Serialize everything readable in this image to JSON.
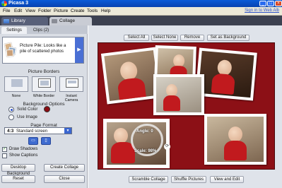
{
  "window": {
    "title": "Picasa 3"
  },
  "menubar": {
    "items": [
      "File",
      "Edit",
      "View",
      "Folder",
      "Picture",
      "Create",
      "Tools",
      "Help"
    ],
    "signin": "Sign in to Web Alb"
  },
  "tabs": {
    "library": "Library",
    "collage": "Collage"
  },
  "panel": {
    "subtabs": {
      "settings": "Settings",
      "clips": "Clips (2)"
    },
    "style": {
      "text": "Picture Pile: Looks like a pile of scattered photos"
    },
    "borders": {
      "title": "Picture Borders",
      "options": [
        {
          "label": "None"
        },
        {
          "label": "White Border"
        },
        {
          "label": "Instant Camera"
        }
      ]
    },
    "background": {
      "title": "Background Options",
      "solid": "Solid Color",
      "image": "Use Image",
      "color": "#8c1016"
    },
    "format": {
      "title": "Page Format",
      "ratio": "4:3",
      "name": "Standard screen"
    },
    "checks": {
      "shadows": "Draw Shadows",
      "captions": "Show Captions"
    },
    "buttons": {
      "desktop": "Desktop Background",
      "create": "Create Collage",
      "reset": "Reset",
      "close": "Close"
    }
  },
  "toolbar": {
    "select_all": "Select All",
    "select_none": "Select None",
    "remove": "Remove",
    "set_background": "Set as Background"
  },
  "rotation": {
    "angle": "Angle: 0",
    "scale": "Scale: 98%"
  },
  "bottom": {
    "scramble": "Scramble Collage",
    "shuffle": "Shuffle Pictures",
    "view_edit": "View and Edit"
  }
}
